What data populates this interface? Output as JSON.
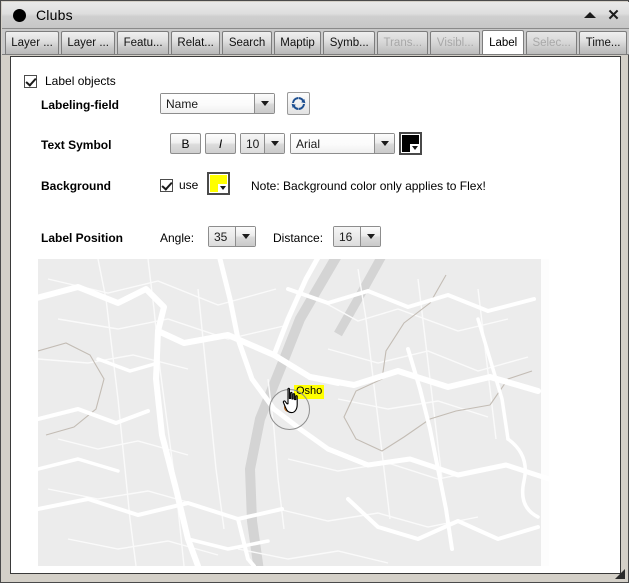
{
  "window": {
    "title": "Clubs",
    "icon": "black-circle-icon",
    "collapse_label": "▲",
    "close_label": "✕"
  },
  "tabs": [
    {
      "label": "Layer ...",
      "state": "normal"
    },
    {
      "label": "Layer ...",
      "state": "normal"
    },
    {
      "label": "Featu...",
      "state": "normal"
    },
    {
      "label": "Relat...",
      "state": "normal"
    },
    {
      "label": "Search",
      "state": "normal"
    },
    {
      "label": "Maptip",
      "state": "normal"
    },
    {
      "label": "Symb...",
      "state": "normal"
    },
    {
      "label": "Trans...",
      "state": "disabled"
    },
    {
      "label": "Visibl...",
      "state": "disabled"
    },
    {
      "label": "Label",
      "state": "active"
    },
    {
      "label": "Selec...",
      "state": "disabled"
    },
    {
      "label": "Time...",
      "state": "normal"
    }
  ],
  "form": {
    "label_objects": {
      "label": "Label objects",
      "checked": true
    },
    "labeling_field": {
      "label": "Labeling-field",
      "value": "Name",
      "refresh_icon": "refresh-icon"
    },
    "text_symbol": {
      "label": "Text Symbol",
      "bold_label": "B",
      "italic_label": "I",
      "size_value": "10",
      "font_value": "Arial",
      "color": "#000000"
    },
    "background": {
      "label": "Background",
      "use_label": "use",
      "use_checked": true,
      "color": "#ffff00",
      "note": "Note: Background color only applies to Flex!"
    },
    "label_position": {
      "label": "Label Position",
      "angle_label": "Angle:",
      "angle_value": "35",
      "distance_label": "Distance:",
      "distance_value": "16"
    }
  },
  "map": {
    "marker_label": "Osho",
    "marker_label_bg": "#ffff00",
    "point_color": "#e8832e",
    "land_color": "#ececec",
    "road_color": "#ffffff",
    "water_color": "#d5d5d5",
    "cursor_icon": "hand-pointer-cursor"
  }
}
